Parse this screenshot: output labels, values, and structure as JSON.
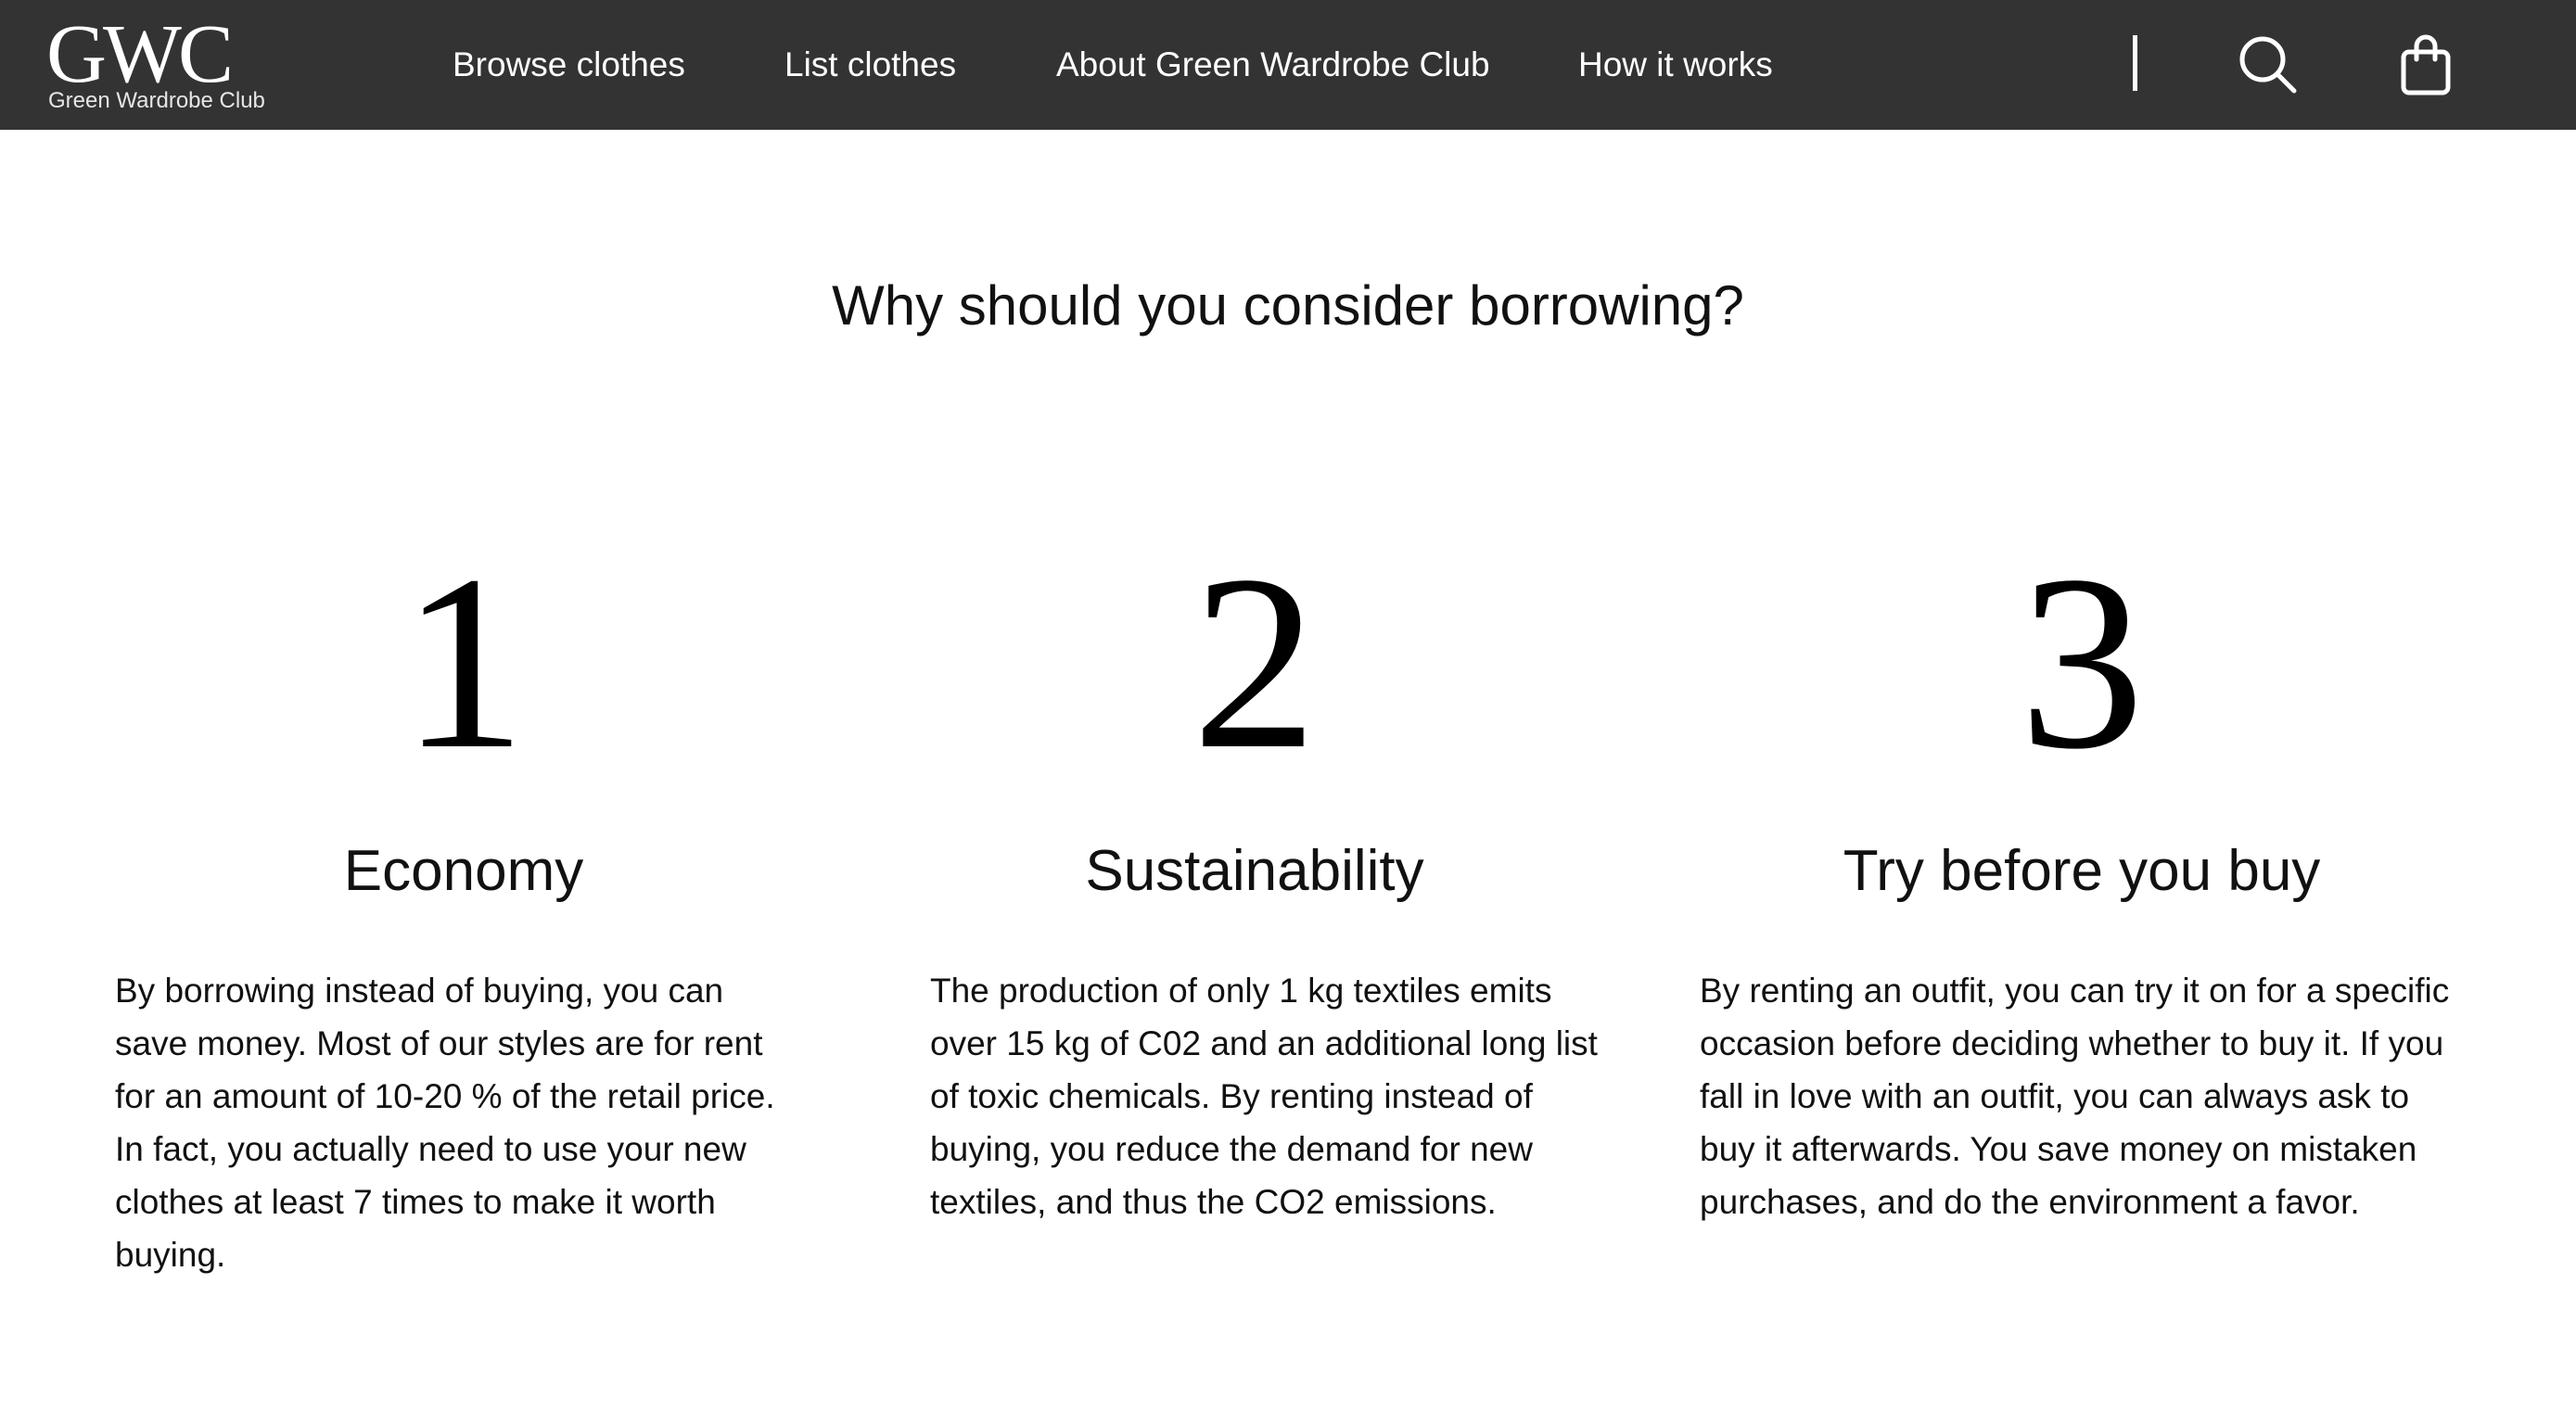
{
  "header": {
    "logo_mark": "GWC",
    "logo_subtitle": "Green Wardrobe Club",
    "nav": [
      {
        "label": "Browse clothes"
      },
      {
        "label": "List clothes"
      },
      {
        "label": "About Green Wardrobe Club"
      },
      {
        "label": "How it works"
      }
    ],
    "icons": {
      "search": "search-icon",
      "cart": "shopping-bag-icon"
    }
  },
  "main": {
    "title": "Why should you consider borrowing?",
    "reasons": [
      {
        "number": "1",
        "heading": "Economy",
        "body": "By borrowing instead of buying, you can save money. Most of our styles are for rent for an amount of 10-20 % of the retail price. In fact, you actually need to use your new clothes at least 7 times to make it worth buying."
      },
      {
        "number": "2",
        "heading": "Sustainability",
        "body": "The production of only 1 kg textiles emits over 15 kg of C02 and an additional long list of toxic chemicals. By renting instead of buying, you reduce the demand for new textiles, and thus the CO2 emissions."
      },
      {
        "number": "3",
        "heading": "Try before you buy",
        "body": "By renting an outfit, you can try it on for a specific occasion before deciding whether to buy it. If you fall in love with an outfit, you can always ask to buy it afterwards. You save money on mistaken purchases, and do the environment a favor."
      }
    ]
  },
  "colors": {
    "header_bg": "#333333",
    "header_text": "#ffffff",
    "page_bg": "#ffffff",
    "body_text": "#111111"
  }
}
